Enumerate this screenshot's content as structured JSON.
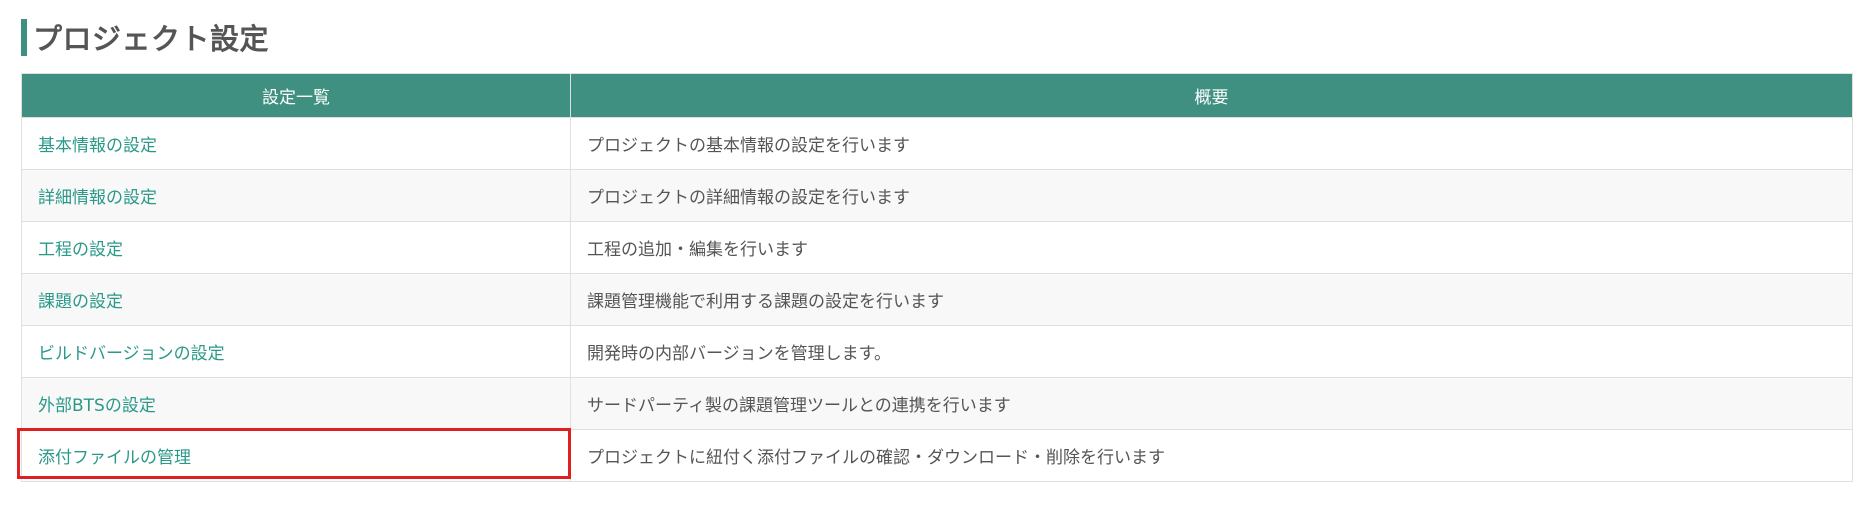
{
  "page": {
    "title": "プロジェクト設定"
  },
  "table": {
    "headers": [
      "設定一覧",
      "概要"
    ],
    "rows": [
      {
        "name": "基本情報の設定",
        "description": "プロジェクトの基本情報の設定を行います"
      },
      {
        "name": "詳細情報の設定",
        "description": "プロジェクトの詳細情報の設定を行います"
      },
      {
        "name": "工程の設定",
        "description": "工程の追加・編集を行います"
      },
      {
        "name": "課題の設定",
        "description": "課題管理機能で利用する課題の設定を行います"
      },
      {
        "name": "ビルドバージョンの設定",
        "description": "開発時の内部バージョンを管理します。"
      },
      {
        "name": "外部BTSの設定",
        "description": "サードパーティ製の課題管理ツールとの連携を行います"
      },
      {
        "name": "添付ファイルの管理",
        "description": "プロジェクトに紐付く添付ファイルの確認・ダウンロード・削除を行います"
      }
    ]
  },
  "colors": {
    "accent": "#3f9081",
    "link": "#2a9988",
    "highlight": "#e02020"
  }
}
